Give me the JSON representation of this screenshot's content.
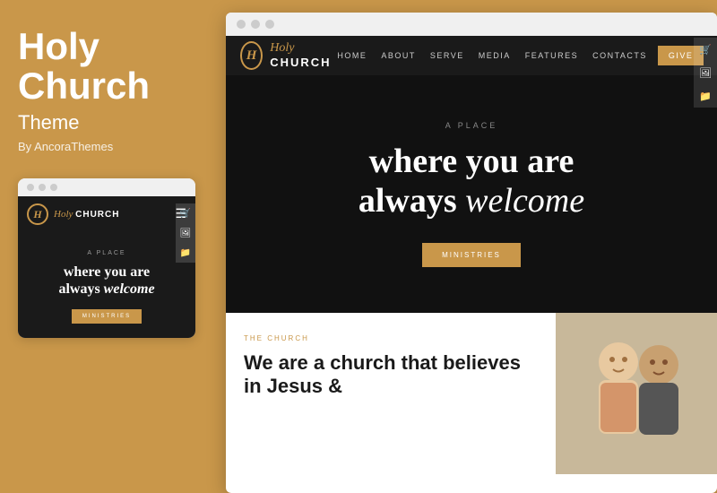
{
  "left": {
    "title_line1": "Holy",
    "title_line2": "Church",
    "subtitle": "Theme",
    "by": "By AncoraThemes"
  },
  "mobile_preview": {
    "logo_italic": "Holy",
    "logo_bold": "CHURCH",
    "logo_letter": "H",
    "hero_small": "A PLACE",
    "hero_line1": "where you are",
    "hero_line2": "always",
    "hero_italic": "welcome",
    "btn_label": "MINISTRIES"
  },
  "desktop": {
    "nav": {
      "logo_italic": "Holy",
      "logo_bold": "CHURCH",
      "logo_letter": "H",
      "links": [
        "HOME",
        "ABOUT",
        "SERVE",
        "MEDIA",
        "FEATURES",
        "CONTACTS"
      ],
      "give": "GIVE"
    },
    "hero": {
      "small": "A PLACE",
      "line1": "where you are",
      "line2": "always",
      "italic": "welcome",
      "btn": "MINISTRIES"
    },
    "bottom": {
      "tag": "THE CHURCH",
      "title": "We are a church that believes in Jesus &"
    }
  },
  "icons": {
    "cart": "🛒",
    "image": "🖼",
    "folder": "📁"
  }
}
